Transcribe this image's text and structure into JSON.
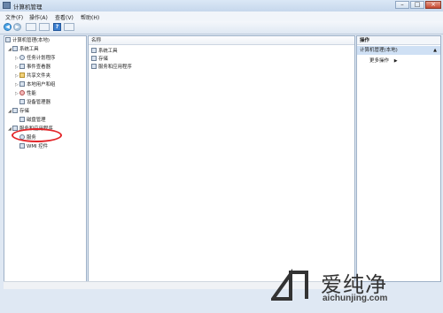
{
  "window": {
    "title": "计算机管理"
  },
  "menu": [
    {
      "label": "文件(F)"
    },
    {
      "label": "操作(A)"
    },
    {
      "label": "查看(V)"
    },
    {
      "label": "帮助(H)"
    }
  ],
  "tree": {
    "root": "计算机管理(本地)",
    "items": [
      {
        "label": "系统工具",
        "icon": "tools-icon"
      },
      {
        "label": "任务计划程序",
        "icon": "clock-icon"
      },
      {
        "label": "事件查看器",
        "icon": "event-viewer-icon"
      },
      {
        "label": "共享文件夹",
        "icon": "shared-folder-icon"
      },
      {
        "label": "本地用户和组",
        "icon": "users-icon"
      },
      {
        "label": "性能",
        "icon": "performance-icon"
      },
      {
        "label": "设备管理器",
        "icon": "device-manager-icon"
      },
      {
        "label": "存储",
        "icon": "storage-icon"
      },
      {
        "label": "磁盘管理",
        "icon": "disk-icon"
      },
      {
        "label": "服务和应用程序",
        "icon": "services-apps-icon"
      },
      {
        "label": "服务",
        "icon": "services-icon"
      },
      {
        "label": "WMI 控件",
        "icon": "wmi-icon"
      }
    ]
  },
  "list": {
    "header": "名称",
    "items": [
      {
        "label": "系统工具"
      },
      {
        "label": "存储"
      },
      {
        "label": "服务和应用程序"
      }
    ]
  },
  "actions": {
    "header": "操作",
    "selected": "计算机管理(本地)",
    "more": "更多操作"
  },
  "watermark": {
    "cn": "爱纯净",
    "en": "aichunjing.com"
  },
  "colors": {
    "highlight_circle": "#e3262a",
    "selection": "#cfe0f4"
  }
}
